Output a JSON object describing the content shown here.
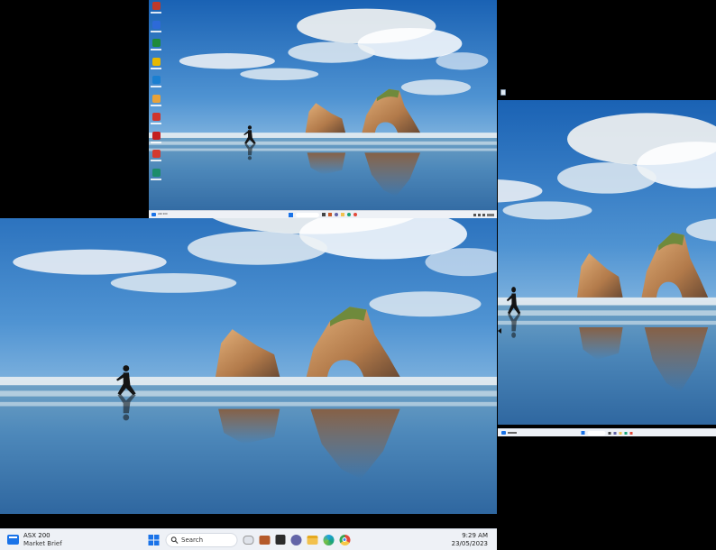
{
  "weather_widget": {
    "line1": "ASX 200",
    "line2": "Market Brief"
  },
  "search": {
    "label": "Search"
  },
  "clock": {
    "time": "9:29 AM",
    "date": "23/05/2023"
  },
  "desktop_icons": [
    {
      "name": "icon-1",
      "color": "#c0392b"
    },
    {
      "name": "icon-2",
      "color": "#2d6ad8"
    },
    {
      "name": "icon-3",
      "color": "#1f8a3a"
    },
    {
      "name": "icon-4",
      "color": "#e6b800"
    },
    {
      "name": "icon-5",
      "color": "#1a7fd1"
    },
    {
      "name": "icon-6",
      "color": "#e8a23a"
    },
    {
      "name": "icon-7",
      "color": "#d0342c"
    },
    {
      "name": "icon-8",
      "color": "#c41e1e"
    },
    {
      "name": "icon-9",
      "color": "#d43a2f"
    },
    {
      "name": "icon-10",
      "color": "#1c8c6a"
    }
  ],
  "colors": {
    "taskbar": "#eef1f6",
    "windows_blue": "#1a73e8",
    "sky_top": "#1f6fbf",
    "sand": "#c9a27a"
  }
}
